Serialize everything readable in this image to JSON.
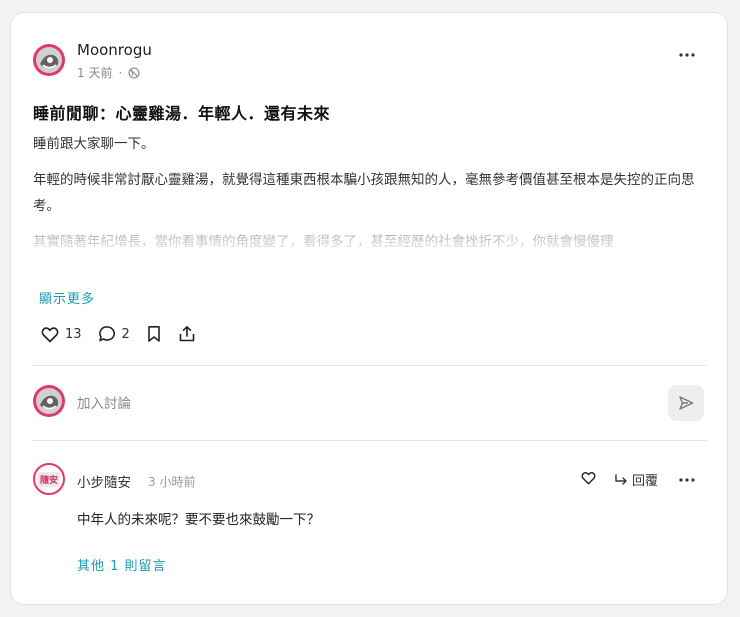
{
  "post": {
    "author": "Moonrogu",
    "time": "1 天前",
    "separator": "·",
    "title": "睡前閒聊：心靈雞湯．年輕人．還有未來",
    "paragraphs": [
      "睡前跟大家聊一下。",
      "年輕的時候非常討厭心靈雞湯，就覺得這種東西根本騙小孩跟無知的人，毫無參考價值甚至根本是失控的正向思考。",
      "其實隨著年紀增長，當你看事情的角度變了，看得多了，甚至經歷的社會挫折不少，你就會慢慢理"
    ],
    "show_more": "顯示更多",
    "like_count": "13",
    "comment_count": "2"
  },
  "composer": {
    "placeholder": "加入討論"
  },
  "comment": {
    "author": "小步隨安",
    "avatar_text": "隨安",
    "time": "3 小時前",
    "reply_label": "回覆",
    "text": "中年人的未來呢？要不要也來鼓勵一下？",
    "more_comments": "其他 1 則留言"
  },
  "colors": {
    "accent": "#1a9bb0",
    "avatar_ring": "#e0396a"
  },
  "icons": {
    "visibility": "globe-icon",
    "like": "heart-icon",
    "comment": "comment-icon",
    "bookmark": "bookmark-icon",
    "share": "share-icon",
    "send": "send-icon",
    "reply": "reply-arrow-icon",
    "more": "more-dots-icon"
  }
}
